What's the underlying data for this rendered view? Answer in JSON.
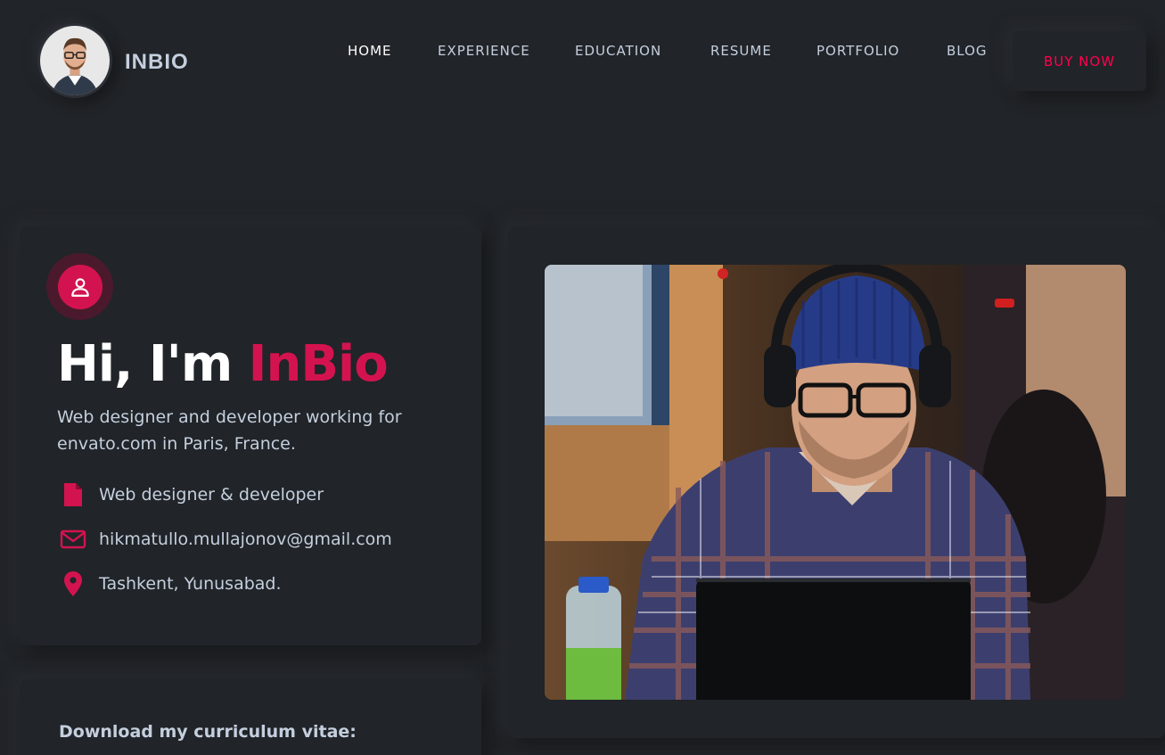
{
  "brand": {
    "name": "INBIO"
  },
  "nav": {
    "items": [
      {
        "label": "HOME",
        "active": true
      },
      {
        "label": "EXPERIENCE",
        "active": false
      },
      {
        "label": "EDUCATION",
        "active": false
      },
      {
        "label": "RESUME",
        "active": false
      },
      {
        "label": "PORTFOLIO",
        "active": false
      },
      {
        "label": "BLOG",
        "active": false
      }
    ],
    "cta": "BUY NOW"
  },
  "hero": {
    "greeting": "Hi, I'm ",
    "name": "InBio",
    "description": "Web designer and developer working for envato.com in Paris, France.",
    "info": [
      {
        "icon": "document-icon",
        "text": "Web designer & developer"
      },
      {
        "icon": "mail-icon",
        "text": "hikmatullo.mullajonov@gmail.com"
      },
      {
        "icon": "location-pin-icon",
        "text": "Tashkent, Yunusabad."
      }
    ],
    "download_label": "Download my curriculum vitae:"
  },
  "colors": {
    "background": "#212428",
    "accent": "#d3134f",
    "text": "#c4cfde",
    "heading": "#ffffff"
  }
}
